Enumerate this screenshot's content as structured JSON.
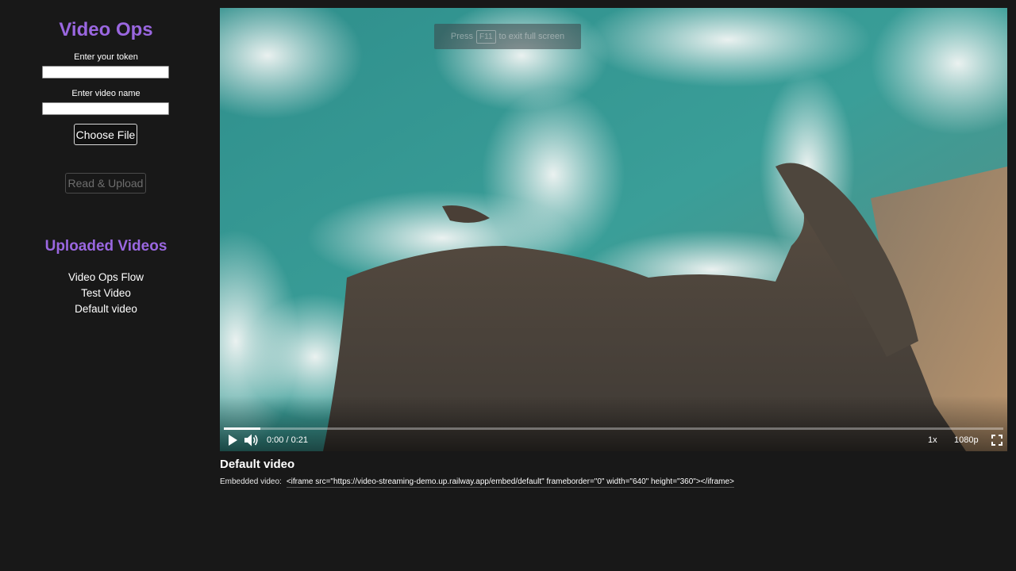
{
  "sidebar": {
    "app_title": "Video Ops",
    "token_label": "Enter your token",
    "token_value": "",
    "video_name_label": "Enter video name",
    "video_name_value": "",
    "choose_file_label": "Choose File",
    "upload_label": "Read & Upload",
    "uploaded_title": "Uploaded Videos",
    "videos": [
      {
        "label": "Video Ops Flow"
      },
      {
        "label": "Test Video"
      },
      {
        "label": "Default video"
      }
    ]
  },
  "player": {
    "fullscreen_hint_before": "Press",
    "fullscreen_hint_key": "F11",
    "fullscreen_hint_after": "to exit full screen",
    "time": "0:00 / 0:21",
    "progress_fraction": 0.047,
    "speed": "1x",
    "quality": "1080p",
    "icons": {
      "play": "play-icon",
      "volume": "volume-icon",
      "fullscreen": "fullscreen-icon"
    }
  },
  "details": {
    "title": "Default video",
    "embed_label": "Embedded video:",
    "embed_code": "<iframe src=\"https://video-streaming-demo.up.railway.app/embed/default\" frameborder=\"0\" width=\"640\" height=\"360\"></iframe>"
  }
}
